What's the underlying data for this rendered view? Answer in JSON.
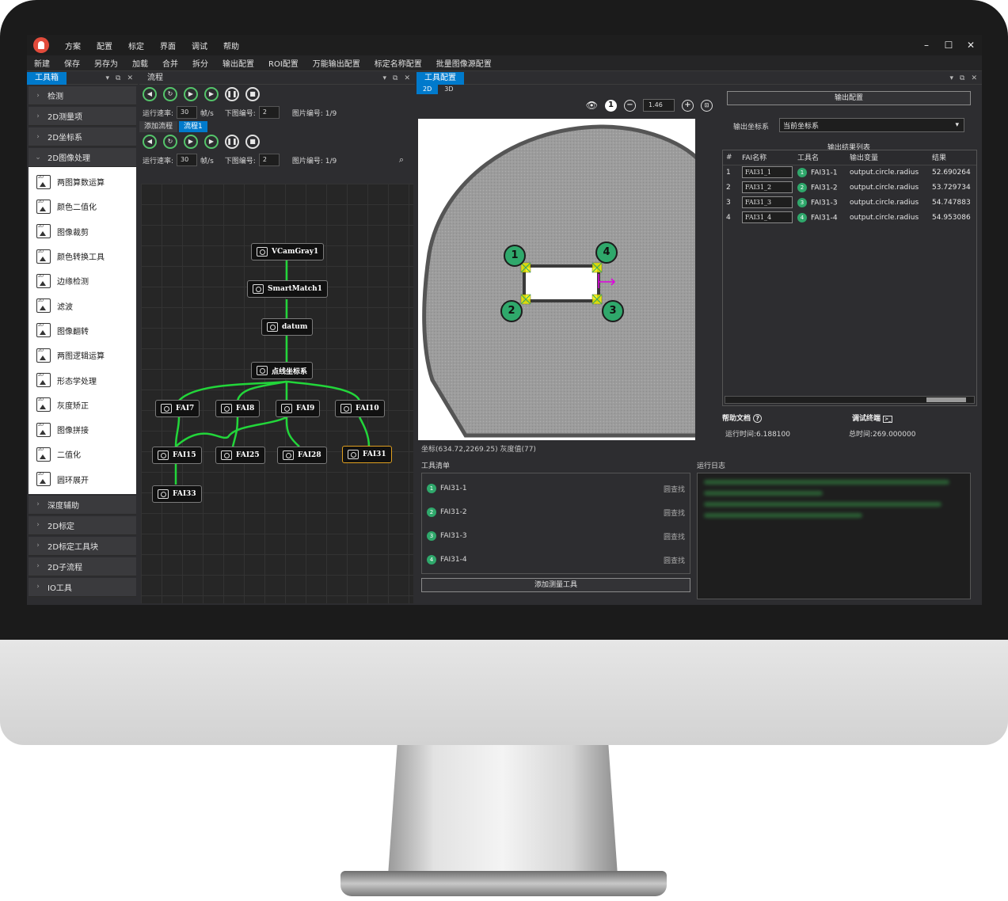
{
  "menu": [
    "方案",
    "配置",
    "标定",
    "界面",
    "调试",
    "帮助"
  ],
  "toolbar": [
    "新建",
    "保存",
    "另存为",
    "加载",
    "合并",
    "拆分",
    "输出配置",
    "ROI配置",
    "万能输出配置",
    "标定名称配置",
    "批量图像源配置"
  ],
  "window_controls": [
    "–",
    "☐",
    "✕"
  ],
  "toolbox": {
    "tab": "工具箱",
    "categories_top": [
      "检测",
      "2D测量项",
      "2D坐标系",
      "2D图像处理"
    ],
    "tools": [
      "两图算数运算",
      "颜色二值化",
      "图像裁剪",
      "颜色转换工具",
      "边缘检测",
      "滤波",
      "图像翻转",
      "两图逻辑运算",
      "形态学处理",
      "灰度矫正",
      "图像拼接",
      "二值化",
      "圆环展开"
    ],
    "categories_bottom": [
      "深度辅助",
      "2D标定",
      "2D标定工具块",
      "2D子流程",
      "IO工具"
    ]
  },
  "flow": {
    "tab": "流程",
    "run_rate_label": "运行速率:",
    "run_rate_value": "30",
    "fps_unit": "帧/s",
    "next_image_label": "下图编号:",
    "next_image_value": "2",
    "image_no_label": "图片编号: 1/9",
    "add_flow": "添加流程",
    "flow_tab": "流程1",
    "nodes": {
      "vcam": "VCamGray1",
      "smart": "SmartMatch1",
      "datum": "datum",
      "coord": "点线坐标系",
      "fai7": "FAI7",
      "fai8": "FAI8",
      "fai9": "FAI9",
      "fai10": "FAI10",
      "fai15": "FAI15",
      "fai25": "FAI25",
      "fai28": "FAI28",
      "fai31": "FAI31",
      "fai33": "FAI33"
    }
  },
  "tool_config": {
    "tab": "工具配置",
    "subtabs": [
      "2D",
      "3D"
    ],
    "zoom": "1.46",
    "coord_status": "坐标(634.72,2269.25) 灰度值(77)",
    "markers": [
      "1",
      "2",
      "3",
      "4"
    ]
  },
  "output": {
    "button": "输出配置",
    "coord_label": "输出坐标系",
    "coord_value": "当前坐标系",
    "list_title": "输出结果列表",
    "headers": [
      "#",
      "FAI名称",
      "工具名",
      "输出变量",
      "结果"
    ],
    "rows": [
      {
        "idx": "1",
        "fai": "FAI31_1",
        "tool": "FAI31-1",
        "var": "output.circle.radius",
        "result": "52.690264"
      },
      {
        "idx": "2",
        "fai": "FAI31_2",
        "tool": "FAI31-2",
        "var": "output.circle.radius",
        "result": "53.729734"
      },
      {
        "idx": "3",
        "fai": "FAI31_3",
        "tool": "FAI31-3",
        "var": "output.circle.radius",
        "result": "54.747883"
      },
      {
        "idx": "4",
        "fai": "FAI31_4",
        "tool": "FAI31-4",
        "var": "output.circle.radius",
        "result": "54.953086"
      }
    ],
    "help_doc": "帮助文档",
    "debug_terminal": "调试终端",
    "run_time": "运行时间:6.188100",
    "total_time": "总时间:269.000000"
  },
  "tool_list": {
    "title": "工具清单",
    "items": [
      {
        "num": "1",
        "name": "FAI31-1",
        "action": "圆查找"
      },
      {
        "num": "2",
        "name": "FAI31-2",
        "action": "圆查找"
      },
      {
        "num": "3",
        "name": "FAI31-3",
        "action": "圆查找"
      },
      {
        "num": "4",
        "name": "FAI31-4",
        "action": "圆查找"
      }
    ],
    "add_button": "添加测量工具"
  },
  "log": {
    "title": "运行日志"
  },
  "colors": {
    "accent": "#007acc",
    "node_edge": "#22d63a",
    "marker": "#2fa86b"
  }
}
